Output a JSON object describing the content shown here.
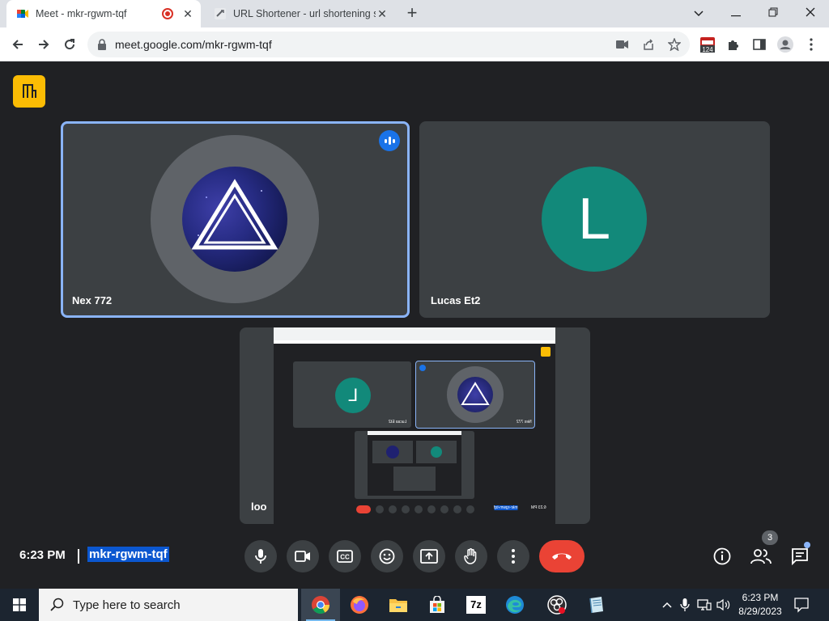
{
  "browser": {
    "tabs": [
      {
        "title": "Meet - mkr-rgwm-tqf",
        "active": true,
        "recording": true
      },
      {
        "title": "URL Shortener - url shortening se",
        "active": false
      }
    ],
    "url": "meet.google.com/mkr-rgwm-tqf",
    "extension_badge": "124"
  },
  "meet": {
    "participants": [
      {
        "name": "Nex 772",
        "speaking": true,
        "avatar": "triangle-image"
      },
      {
        "name": "Lucas Et2",
        "speaking": false,
        "avatar_letter": "L"
      },
      {
        "name": "loo",
        "speaking": false,
        "avatar": "screen-share"
      }
    ],
    "shared_screen_text": {
      "mirrored_name_1": "Lucas Et2",
      "mirrored_name_2": "Nex 772",
      "mirrored_time": "6:23 PM",
      "mirrored_code": "mkr-rgwm-tqf",
      "mirrored_letter": "L"
    },
    "bottom": {
      "time": "6:23 PM",
      "meeting_code": "mkr-rgwm-tqf",
      "people_count": "3"
    }
  },
  "taskbar": {
    "search_placeholder": "Type here to search",
    "apps": [
      "chrome",
      "firefox",
      "file-explorer",
      "store",
      "7zip",
      "edge",
      "obs",
      "notepad"
    ],
    "seven_zip_label": "7z",
    "time": "6:23 PM",
    "date": "8/29/2023"
  },
  "colors": {
    "meet_bg": "#202124",
    "tile_bg": "#3c4043",
    "speaking_outline": "#8ab4f8",
    "avatar_teal": "#12897a",
    "end_call": "#ea4335",
    "host_tool": "#fbbc04"
  }
}
